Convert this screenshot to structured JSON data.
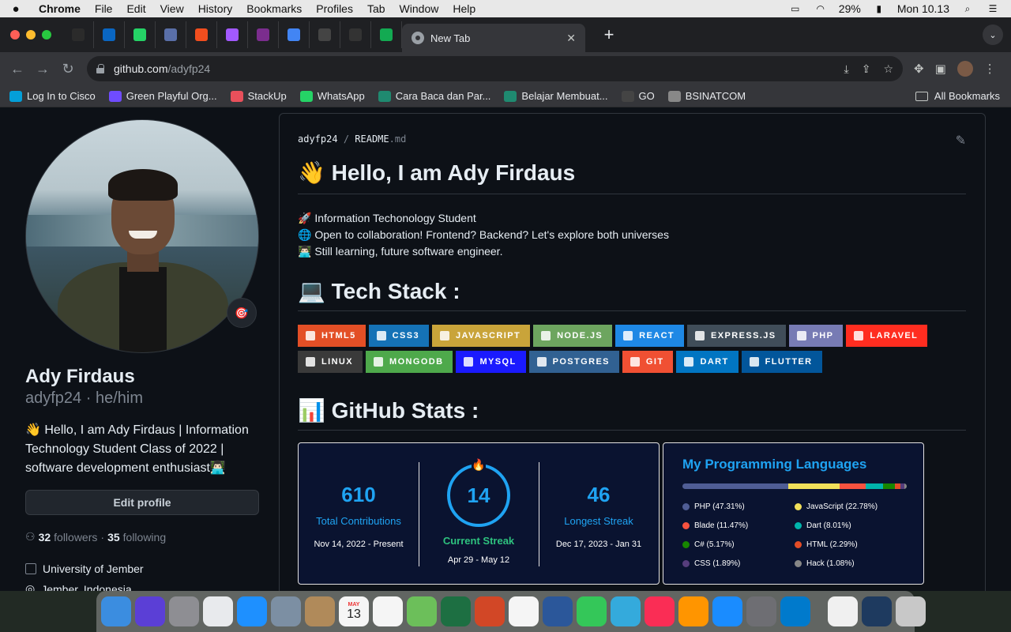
{
  "menubar": {
    "app": "Chrome",
    "items": [
      "File",
      "Edit",
      "View",
      "History",
      "Bookmarks",
      "Profiles",
      "Tab",
      "Window",
      "Help"
    ],
    "battery": "29%",
    "clock": "Mon 10.13"
  },
  "tabs": {
    "active_title": "New Tab",
    "mini_tabs": [
      {
        "icon": "github-icon",
        "color": "#2b2b2b"
      },
      {
        "icon": "linkedin-icon",
        "color": "#0a66c2"
      },
      {
        "icon": "whatsapp-icon",
        "color": "#25d366"
      },
      {
        "icon": "server-icon",
        "color": "#5a6fa8"
      },
      {
        "icon": "figma-icon",
        "color": "#f24e1e"
      },
      {
        "icon": "figma-icon",
        "color": "#a259ff"
      },
      {
        "icon": "p-icon",
        "color": "#7b2d8e"
      },
      {
        "icon": "docs-icon",
        "color": "#4285f4"
      },
      {
        "icon": "dark-icon",
        "color": "#444"
      },
      {
        "icon": "chatgpt-icon",
        "color": "#333"
      },
      {
        "icon": "leaf-icon",
        "color": "#13aa52"
      }
    ]
  },
  "toolbar": {
    "url_host": "github.com",
    "url_path": "/adyfp24"
  },
  "bookmarks": {
    "items": [
      {
        "label": "Log In to Cisco",
        "color": "#049fd9"
      },
      {
        "label": "Green Playful Org...",
        "color": "#6f4cff"
      },
      {
        "label": "StackUp",
        "color": "#e8505b"
      },
      {
        "label": "WhatsApp",
        "color": "#25d366"
      },
      {
        "label": "Cara Baca dan Par...",
        "color": "#1f8a70"
      },
      {
        "label": "Belajar Membuat...",
        "color": "#1f8a70"
      },
      {
        "label": "GO",
        "color": "#444"
      },
      {
        "label": "BSINATCOM",
        "color": "#888"
      }
    ],
    "all": "All Bookmarks"
  },
  "profile": {
    "name": "Ady Firdaus",
    "login_line": "adyfp24 · he/him",
    "bio": "👋 Hello, I am Ady Firdaus | Information Technology Student Class of 2022 | software development enthusiast👨🏻‍💻",
    "edit_label": "Edit profile",
    "followers_count": "32",
    "followers_label": "followers",
    "dot": "·",
    "following_count": "35",
    "following_label": "following",
    "org": "University of Jember",
    "location": "Jember, Indonesia",
    "status_emoji": "🎯"
  },
  "readme": {
    "owner": "adyfp24",
    "sep": "/",
    "file": "README",
    "ext": ".md",
    "h1": "👋 Hello, I am Ady Firdaus",
    "lines": [
      "🚀 Information Techonology Student",
      "🌐 Open to collaboration! Frontend? Backend? Let's explore both universes",
      "👨🏻‍💻 Still learning, future software engineer."
    ],
    "tech_title": "💻 Tech Stack :",
    "badges": [
      {
        "label": "HTML5",
        "color": "#e34f26"
      },
      {
        "label": "CSS3",
        "color": "#1572b6"
      },
      {
        "label": "JAVASCRIPT",
        "color": "#c9a43a"
      },
      {
        "label": "NODE.JS",
        "color": "#6da55f"
      },
      {
        "label": "REACT",
        "color": "#1e88e5"
      },
      {
        "label": "EXPRESS.JS",
        "color": "#404d59"
      },
      {
        "label": "PHP",
        "color": "#777bb4"
      },
      {
        "label": "LARAVEL",
        "color": "#ff2d20"
      },
      {
        "label": "LINUX",
        "color": "#3a3a3a"
      },
      {
        "label": "MONGODB",
        "color": "#4ea94b"
      },
      {
        "label": "MYSQL",
        "color": "#1a1aff"
      },
      {
        "label": "POSTGRES",
        "color": "#316192"
      },
      {
        "label": "GIT",
        "color": "#f05033"
      },
      {
        "label": "DART",
        "color": "#0175c2"
      },
      {
        "label": "FLUTTER",
        "color": "#02569b"
      }
    ],
    "stats_title": "📊 GitHub Stats :"
  },
  "streak": {
    "total": "610",
    "total_label": "Total Contributions",
    "total_range": "Nov 14, 2022 - Present",
    "current": "14",
    "current_label": "Current Streak",
    "current_range": "Apr 29 - May 12",
    "longest": "46",
    "longest_label": "Longest Streak",
    "longest_range": "Dec 17, 2023 - Jan 31"
  },
  "languages": {
    "title": "My Programming Languages",
    "items": [
      {
        "name": "PHP",
        "pct": 47.31,
        "color": "#4f5d95"
      },
      {
        "name": "JavaScript",
        "pct": 22.78,
        "color": "#f1e05a"
      },
      {
        "name": "Blade",
        "pct": 11.47,
        "color": "#f7523f"
      },
      {
        "name": "Dart",
        "pct": 8.01,
        "color": "#00b4ab"
      },
      {
        "name": "C#",
        "pct": 5.17,
        "color": "#178600"
      },
      {
        "name": "HTML",
        "pct": 2.29,
        "color": "#e34c26"
      },
      {
        "name": "CSS",
        "pct": 1.89,
        "color": "#563d7c"
      },
      {
        "name": "Hack",
        "pct": 1.08,
        "color": "#878787"
      }
    ],
    "labels": [
      "PHP (47.31%)",
      "JavaScript (22.78%)",
      "Blade (11.47%)",
      "Dart (8.01%)",
      "C# (5.17%)",
      "HTML (2.29%)",
      "CSS (1.89%)",
      "Hack (1.08%)"
    ]
  },
  "dock": {
    "apps": [
      {
        "icon": "finder-icon",
        "color": "#3b8de0"
      },
      {
        "icon": "siri-icon",
        "color": "#5b3fd6"
      },
      {
        "icon": "launchpad-icon",
        "color": "#8e8e93"
      },
      {
        "icon": "chrome-icon",
        "color": "#e8eaed"
      },
      {
        "icon": "safari-icon",
        "color": "#1e90ff"
      },
      {
        "icon": "preview-icon",
        "color": "#7c8fa3"
      },
      {
        "icon": "contacts-icon",
        "color": "#b08a5a"
      },
      {
        "icon": "calendar-icon",
        "color": "#f5f5f5"
      },
      {
        "icon": "reminders-icon",
        "color": "#f5f5f5"
      },
      {
        "icon": "maps-icon",
        "color": "#6cbf5a"
      },
      {
        "icon": "excel-icon",
        "color": "#1d6f42"
      },
      {
        "icon": "powerpoint-icon",
        "color": "#d24726"
      },
      {
        "icon": "photos-icon",
        "color": "#f5f5f5"
      },
      {
        "icon": "word-icon",
        "color": "#2b579a"
      },
      {
        "icon": "facetime-icon",
        "color": "#34c759"
      },
      {
        "icon": "messages-icon",
        "color": "#34aadc"
      },
      {
        "icon": "music-icon",
        "color": "#fa2d55"
      },
      {
        "icon": "books-icon",
        "color": "#ff9500"
      },
      {
        "icon": "appstore-icon",
        "color": "#1a8cff"
      },
      {
        "icon": "system-preferences-icon",
        "color": "#6e6e73"
      },
      {
        "icon": "vscode-icon",
        "color": "#007acc"
      }
    ],
    "calendar_month": "MAY",
    "calendar_day": "13"
  }
}
